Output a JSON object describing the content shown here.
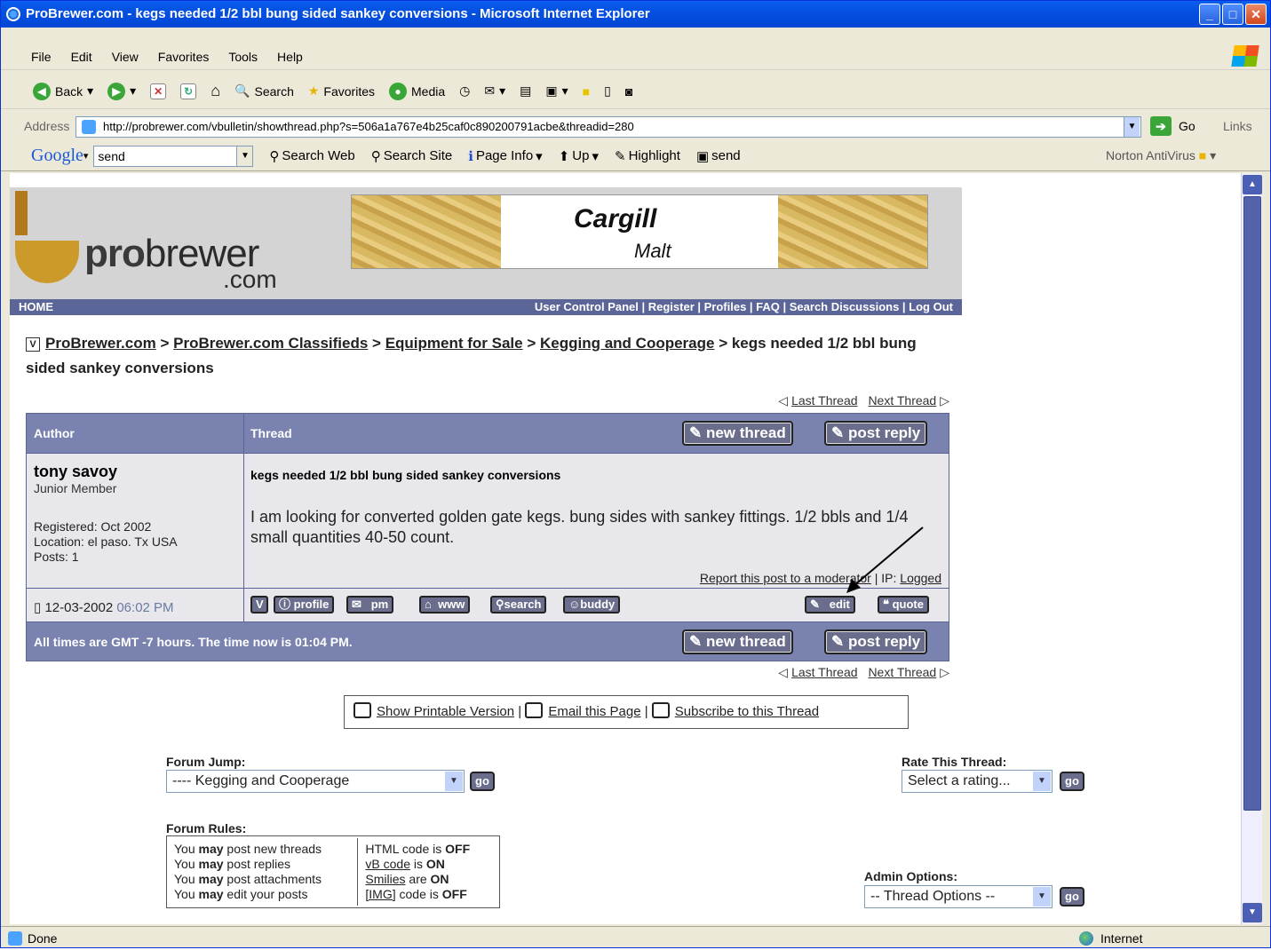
{
  "window": {
    "title": "ProBrewer.com - kegs needed 1/2 bbl bung sided sankey conversions - Microsoft Internet Explorer"
  },
  "menu": [
    "File",
    "Edit",
    "View",
    "Favorites",
    "Tools",
    "Help"
  ],
  "toolbar": {
    "back": "Back",
    "search": "Search",
    "favorites": "Favorites",
    "media": "Media"
  },
  "address": {
    "label": "Address",
    "url": "http://probrewer.com/vbulletin/showthread.php?s=506a1a767e4b25caf0c890200791acbe&threadid=280",
    "go": "Go",
    "links": "Links"
  },
  "google": {
    "logo": "Google",
    "query": "send",
    "search_web": "Search Web",
    "search_site": "Search Site",
    "page_info": "Page Info",
    "up": "Up",
    "highlight": "Highlight",
    "send": "send",
    "norton": "Norton AntiVirus"
  },
  "banner": {
    "logo_pro": "pro",
    "logo_brewer": "brewer",
    "logo_com": ".com",
    "ad_brand": "Cargill",
    "ad_product": "Malt"
  },
  "nav": {
    "home": "HOME",
    "links": "User Control Panel | Register | Profiles | FAQ | Search Discussions | Log Out"
  },
  "breadcrumb": {
    "items": [
      "ProBrewer.com",
      "ProBrewer.com Classifieds",
      "Equipment for Sale",
      "Kegging and Cooperage"
    ],
    "current": "kegs needed 1/2 bbl bung sided sankey conversions"
  },
  "thread_nav": {
    "last": "Last Thread",
    "next": "Next Thread"
  },
  "table": {
    "col_author": "Author",
    "col_thread": "Thread",
    "new_thread": "new thread",
    "post_reply": "post reply"
  },
  "post": {
    "author": "tony savoy",
    "rank": "Junior Member",
    "registered": "Registered: Oct 2002",
    "location": "Location: el paso. Tx USA",
    "posts": "Posts: 1",
    "title": "kegs needed 1/2 bbl bung sided sankey conversions",
    "body": "I am looking for converted golden gate kegs. bung sides with sankey fittings. 1/2 bbls and 1/4 small quantities 40-50 count.",
    "report": "Report this post to a moderator",
    "ip_label": "| IP:",
    "ip_value": "Logged",
    "date": "12-03-2002",
    "time": "06:02 PM",
    "buttons": [
      "profile",
      "pm",
      "www",
      "search",
      "buddy"
    ],
    "edit": "edit",
    "quote": "quote"
  },
  "footer_time": "All times are GMT -7 hours. The time now is 01:04 PM.",
  "print": {
    "printable": "Show Printable Version",
    "email": "Email this Page",
    "subscribe": "Subscribe to this Thread"
  },
  "forum_jump": {
    "label": "Forum Jump:",
    "value": "---- Kegging and Cooperage",
    "go": "go"
  },
  "rate": {
    "label": "Rate This Thread:",
    "value": "Select a rating...",
    "go": "go"
  },
  "admin": {
    "label": "Admin Options:",
    "value": "-- Thread Options --",
    "go": "go"
  },
  "rules": {
    "label": "Forum Rules:",
    "left": [
      {
        "pre": "You ",
        "b": "may",
        "post": " post new threads"
      },
      {
        "pre": "You ",
        "b": "may",
        "post": " post replies"
      },
      {
        "pre": "You ",
        "b": "may",
        "post": " post attachments"
      },
      {
        "pre": "You ",
        "b": "may",
        "post": " edit your posts"
      }
    ],
    "right": [
      {
        "link": "",
        "pre": "HTML code is ",
        "b": "OFF"
      },
      {
        "link": "vB code",
        "pre": " is ",
        "b": "ON"
      },
      {
        "link": "Smilies",
        "pre": " are ",
        "b": "ON"
      },
      {
        "link": "[IMG]",
        "pre": " code is ",
        "b": "OFF"
      }
    ]
  },
  "status": {
    "text": "Done",
    "zone": "Internet"
  }
}
